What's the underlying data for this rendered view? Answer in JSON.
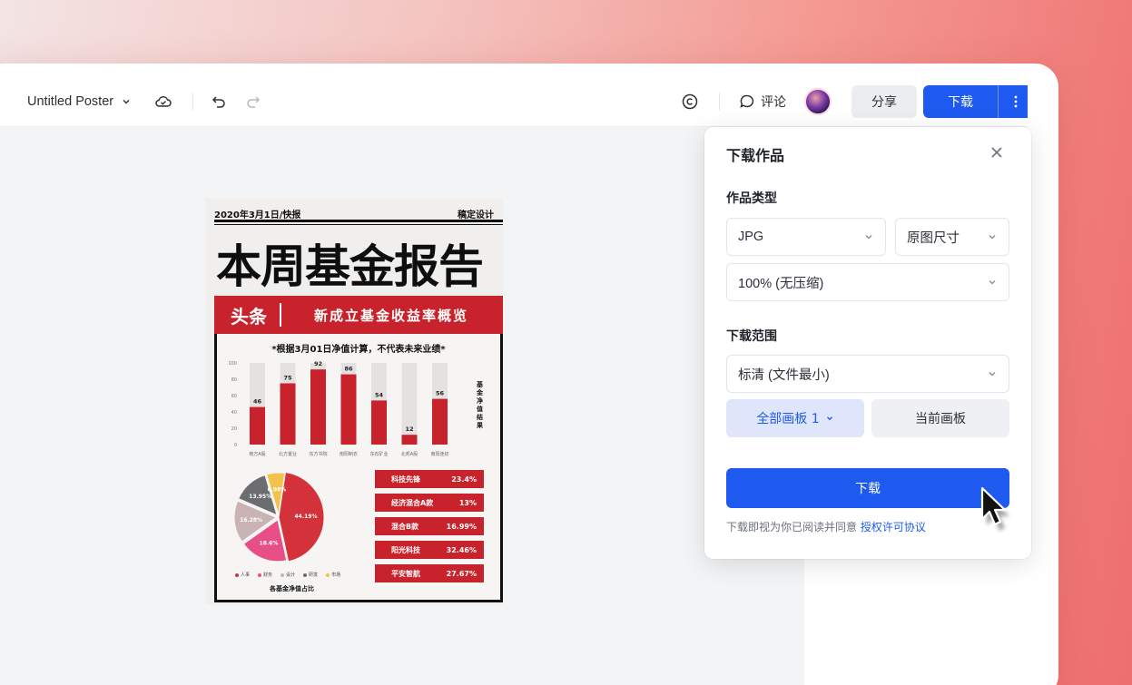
{
  "topbar": {
    "breadcrumb_sep": "/",
    "doc_title": "Untitled Poster",
    "comment_label": "评论",
    "share_label": "分享",
    "download_label": "下载"
  },
  "poster": {
    "date_line": "2020年3月1日/快报",
    "brand": "稿定设计",
    "title": "本周基金报告",
    "banner_tag": "头条",
    "banner_sub": "新成立基金收益率概览",
    "note": "*根据3月01日净值计算，不代表未来业绩*",
    "side_label": "基金净值结果",
    "pie_caption": "各基金净值占比",
    "pie_legend": [
      "人事",
      "财务",
      "设计",
      "研发",
      "市场"
    ],
    "fund_rows": [
      {
        "name": "科技先锋",
        "value": "23.4%"
      },
      {
        "name": "经济混合A款",
        "value": "13%"
      },
      {
        "name": "混合B款",
        "value": "16.99%"
      },
      {
        "name": "阳光科技",
        "value": "32.46%"
      },
      {
        "name": "平安智航",
        "value": "27.67%"
      }
    ]
  },
  "chart_data": [
    {
      "type": "bar",
      "categories": [
        "南方A股",
        "北方置业",
        "东方书院",
        "南阳制衣",
        "东石矿业",
        "北邦A股",
        "南阳连纺"
      ],
      "values": [
        46,
        75,
        92,
        86,
        54,
        12,
        56
      ],
      "ylim": [
        0,
        100
      ],
      "yticks": [
        0,
        20,
        40,
        60,
        80,
        100
      ]
    },
    {
      "type": "pie",
      "labels": [
        "44.19%",
        "18.6%",
        "16.28%",
        "13.95%",
        "6.98%"
      ],
      "values": [
        44.19,
        18.6,
        16.28,
        13.95,
        6.98
      ],
      "colors": [
        "#d3323a",
        "#e84f86",
        "#c9b3b5",
        "#6b6d70",
        "#f2c34a"
      ]
    }
  ],
  "download_panel": {
    "title": "下载作品",
    "type_label": "作品类型",
    "format_value": "JPG",
    "size_value": "原图尺寸",
    "quality_value": "100% (无压缩)",
    "range_label": "下载范围",
    "range_value": "标清 (文件最小)",
    "tab_all": "全部画板 1",
    "tab_current": "当前画板",
    "download_button": "下载",
    "agree_text": "下载即视为你已阅读并同意",
    "agree_link": "授权许可协议"
  },
  "colors": {
    "accent": "#1f5af0",
    "poster_red": "#c8232c"
  }
}
